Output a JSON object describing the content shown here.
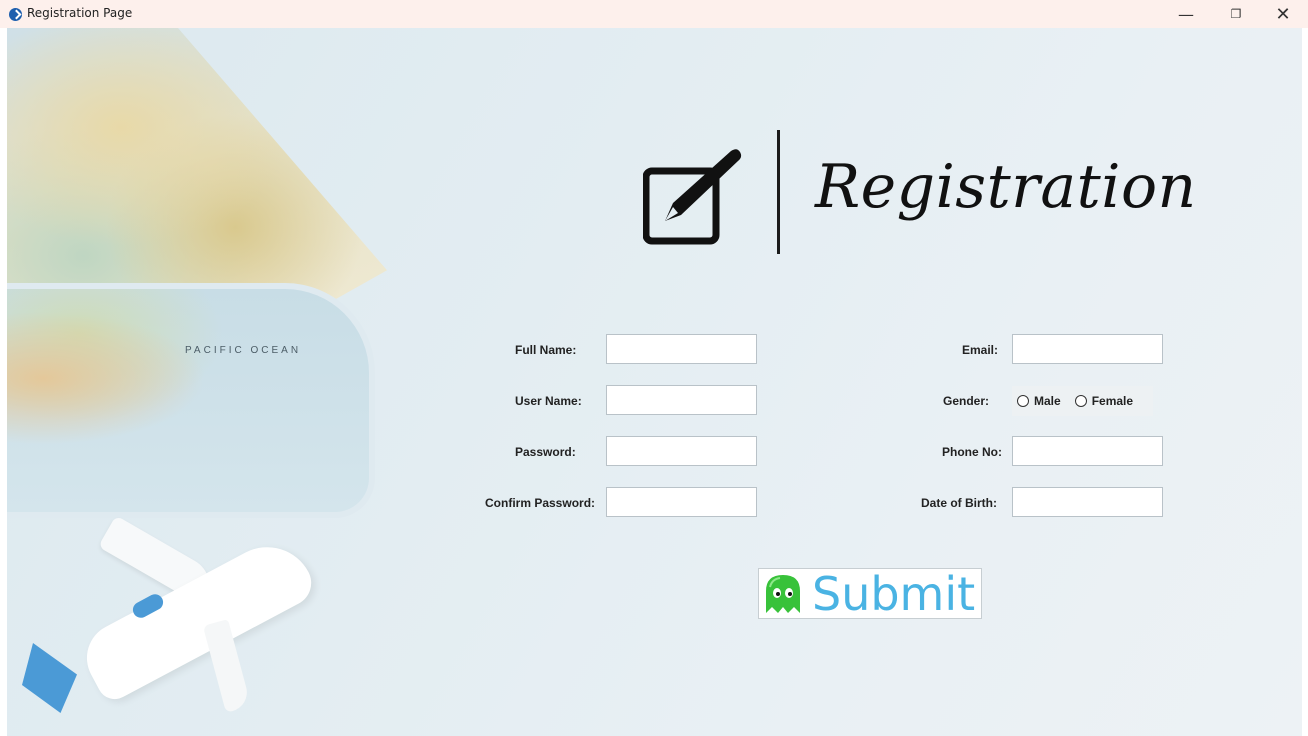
{
  "window": {
    "title": "Registration Page",
    "controls": {
      "minimize": "—",
      "maximize": "❐",
      "close": "✕"
    }
  },
  "background": {
    "map_text": "PACIFIC OCEAN"
  },
  "header": {
    "title": "Registration"
  },
  "form": {
    "left": [
      {
        "label": "Full Name:",
        "value": ""
      },
      {
        "label": "User Name:",
        "value": ""
      },
      {
        "label": "Password:",
        "value": ""
      },
      {
        "label": "Confirm Password:",
        "value": ""
      }
    ],
    "right": {
      "email": {
        "label": "Email:",
        "value": ""
      },
      "gender": {
        "label": "Gender:",
        "options": [
          "Male",
          "Female"
        ]
      },
      "phone": {
        "label": "Phone No:",
        "value": ""
      },
      "dob": {
        "label": "Date of Birth:",
        "value": ""
      }
    },
    "submit_label": "Submit"
  },
  "colors": {
    "submit_text": "#4ab3e3",
    "ghost": "#38c23a",
    "plane_accent": "#4b9ad6"
  }
}
